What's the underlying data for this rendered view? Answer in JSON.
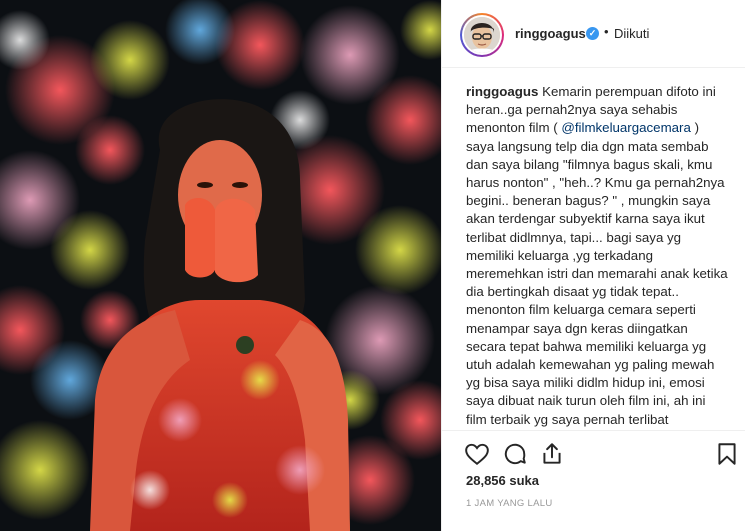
{
  "post": {
    "username": "ringgoagus",
    "verified_badge": "verified-icon",
    "separator": "•",
    "follow_status": "Diikuti",
    "caption_username": "ringgoagus",
    "caption_part1": " Kemarin perempuan difoto ini heran..ga pernah2nya saya sehabis menonton film ( ",
    "caption_mention": "@filmkeluargacemara",
    "caption_part2": " ) saya langsung telp dia dgn mata sembab dan saya bilang \"filmnya bagus skali, kmu harus nonton\" , \"heh..? Kmu ga pernah2nya begini.. beneran bagus? \" , mungkin saya akan terdengar subyektif karna saya ikut terlibat didlmnya, tapi... bagi saya yg memiliki keluarga ,yg terkadang meremehkan istri dan memarahi anak ketika dia bertingkah disaat yg tidak tepat.. menonton film keluarga cemara seperti menampar saya dgn keras diingatkan secara tepat bahwa memiliki keluarga yg utuh adalah kemewahan yg paling mewah yg bisa saya miliki didlm hidup ini, emosi saya dibuat naik turun oleh film ini, ah ini film terbaik yg saya pernah terlibat didalamnya, terimakasih buat seluruh",
    "likes": "28,856 suka",
    "timestamp": "1 JAM YANG LALU"
  },
  "icons": {
    "like": "heart-icon",
    "comment": "comment-icon",
    "share": "share-icon",
    "save": "bookmark-icon"
  },
  "colors": {
    "verified": "#3897f0",
    "mention": "#003569",
    "timestamp": "#999999"
  }
}
